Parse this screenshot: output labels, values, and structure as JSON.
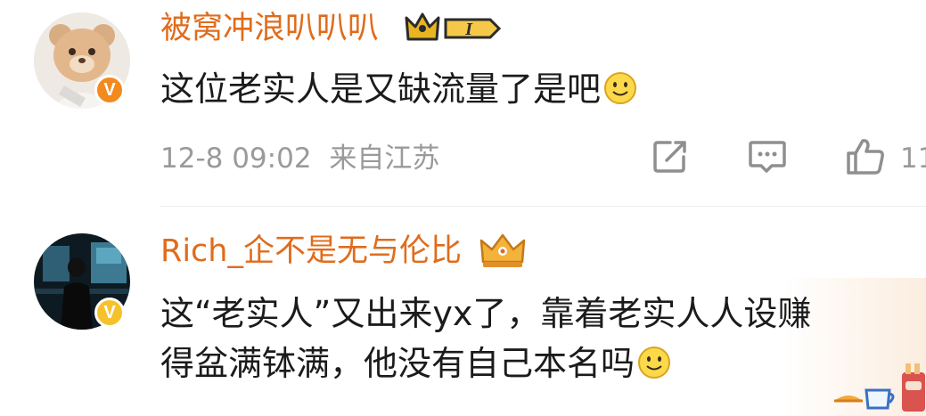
{
  "comments": [
    {
      "username": "被窝冲浪叭叭叭",
      "level_label": "I",
      "text": "这位老实人是又缺流量了是吧",
      "emoji": "smile-emoji",
      "date": "12-8 09:02",
      "location": "来自江苏",
      "like_count": "11",
      "verified": "V"
    },
    {
      "username": "Rich_企不是无与伦比",
      "text_line1": "这“老实人”又出来yx了，靠着老实人人设赚",
      "text_line2": "得盆满钵满，他没有自己本名吗",
      "emoji": "smile-emoji",
      "verified": "V"
    }
  ],
  "colors": {
    "username": "#e06c1c",
    "text": "#1b1b1b",
    "meta": "#9a9a9a",
    "badge_orange": "#f28a1e",
    "badge_gold": "#e8b421"
  }
}
